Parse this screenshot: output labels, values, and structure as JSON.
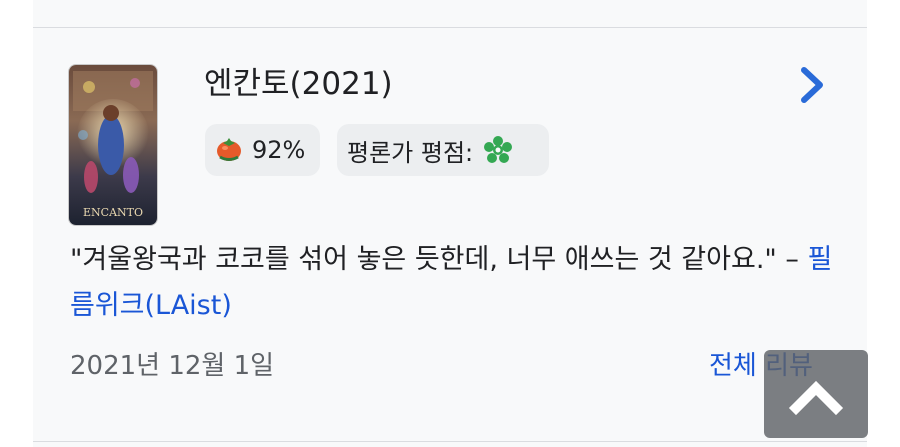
{
  "movie": {
    "title": "엔칸토(2021)",
    "poster_alt": "Encanto"
  },
  "ratings": {
    "audience_score": "92%",
    "critic_label": "평론가 평점:"
  },
  "review": {
    "quote": "\"겨울왕국과 코코를 섞어 놓은 듯한데, 너무 애쓰는 것 같아요.\"",
    "dash": " – ",
    "source": "필름위크(LAist)",
    "date": "2021년 12월 1일",
    "all_reviews_label": "전체 리뷰"
  },
  "colors": {
    "link": "#1a56d6",
    "chevron": "#2a6bd8",
    "flower": "#34a853",
    "tomato": "#d93025"
  },
  "icons": {
    "poster": "movie-poster",
    "chevron": "chevron-right-icon",
    "tomato": "tomato-icon",
    "critic": "flower-icon",
    "scroll_top": "chevron-up-icon"
  }
}
